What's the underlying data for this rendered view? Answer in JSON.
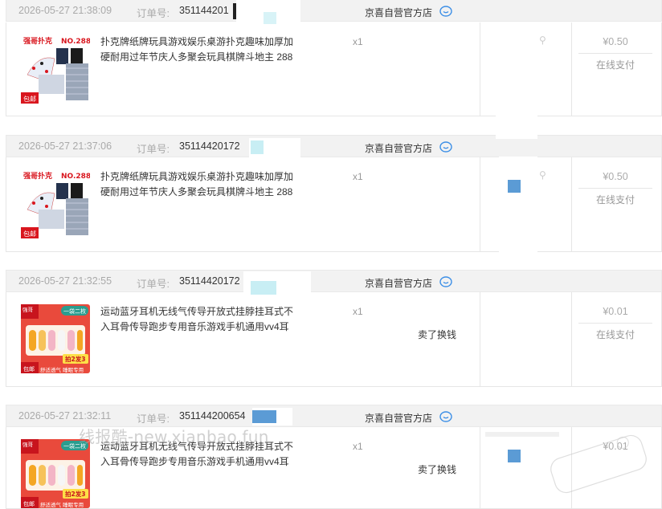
{
  "orders": [
    {
      "date": "2026-05-27 21:38:09",
      "order_label": "订单号:",
      "order_num": "351144201",
      "shop": "京喜自营官方店",
      "title": "扑克牌纸牌玩具游戏娱乐桌游扑克趣味加厚加硬耐用过年节庆人多聚会玩具棋牌斗地主 288",
      "qty": "x1",
      "note": "",
      "price": "¥0.50",
      "pay": "在线支付",
      "thumb": {
        "brand": "强哥扑克",
        "code": "NO.288",
        "tag": "包邮"
      }
    },
    {
      "date": "2026-05-27 21:37:06",
      "order_label": "订单号:",
      "order_num": "35114420172",
      "shop": "京喜自营官方店",
      "title": "扑克牌纸牌玩具游戏娱乐桌游扑克趣味加厚加硬耐用过年节庆人多聚会玩具棋牌斗地主 288",
      "qty": "x1",
      "note": "",
      "price": "¥0.50",
      "pay": "在线支付",
      "thumb": {
        "brand": "强哥扑克",
        "code": "NO.288",
        "tag": "包邮"
      }
    },
    {
      "date": "2026-05-27 21:32:55",
      "order_label": "订单号:",
      "order_num": "35114420172",
      "shop": "京喜自营官方店",
      "title": "运动蓝牙耳机无线气传导开放式挂脖挂耳式不入耳骨传导跑步专用音乐游戏手机通用vv4耳",
      "qty": "x1",
      "note": "卖了换钱",
      "price": "¥0.01",
      "pay": "在线支付",
      "thumb": {
        "brand": "强哥",
        "code": "一袋二枚",
        "tag": "包邮",
        "promo": "拍2发3",
        "footer": "舒适透气 睡眠专用"
      }
    },
    {
      "date": "2026-05-27 21:32:11",
      "order_label": "订单号:",
      "order_num": "351144200654",
      "shop": "京喜自营官方店",
      "title": "运动蓝牙耳机无线气传导开放式挂脖挂耳式不入耳骨传导跑步专用音乐游戏手机通用vv4耳",
      "qty": "x1",
      "note": "卖了换钱",
      "price": "¥0.01",
      "pay": "",
      "thumb": {
        "brand": "强哥",
        "code": "一袋二枚",
        "tag": "包邮",
        "promo": "拍2发3",
        "footer": "舒适透气 睡眠专用"
      }
    }
  ],
  "watermark": "线报酷-new.xianbao.fun",
  "colors": {
    "head_bg": "#f2f2f2",
    "border": "#e6e6e6",
    "accent_red": "#d9161e",
    "chat_blue": "#3b8ee6",
    "mask_blue": "#5b9bd5"
  }
}
